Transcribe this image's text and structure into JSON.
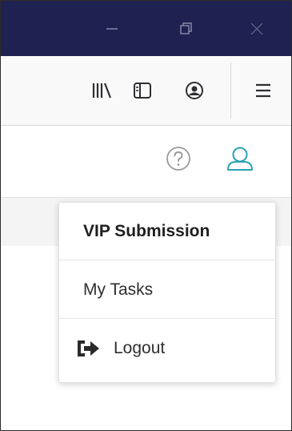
{
  "window": {
    "controls": {
      "minimize_icon": "minimize-icon",
      "restore_icon": "restore-icon",
      "close_icon": "close-icon"
    },
    "titlebar_color": "#1f2150"
  },
  "toolbar": {
    "icons": [
      "library-icon",
      "sidebar-icon",
      "account-icon",
      "hamburger-menu-icon"
    ]
  },
  "header": {
    "icons": [
      "help-icon",
      "user-icon"
    ],
    "accent_color": "#2aa3b5"
  },
  "user_menu": {
    "title": "VIP Submission",
    "items": [
      {
        "label": "My Tasks"
      },
      {
        "label": "Logout",
        "icon": "logout-icon"
      }
    ]
  }
}
